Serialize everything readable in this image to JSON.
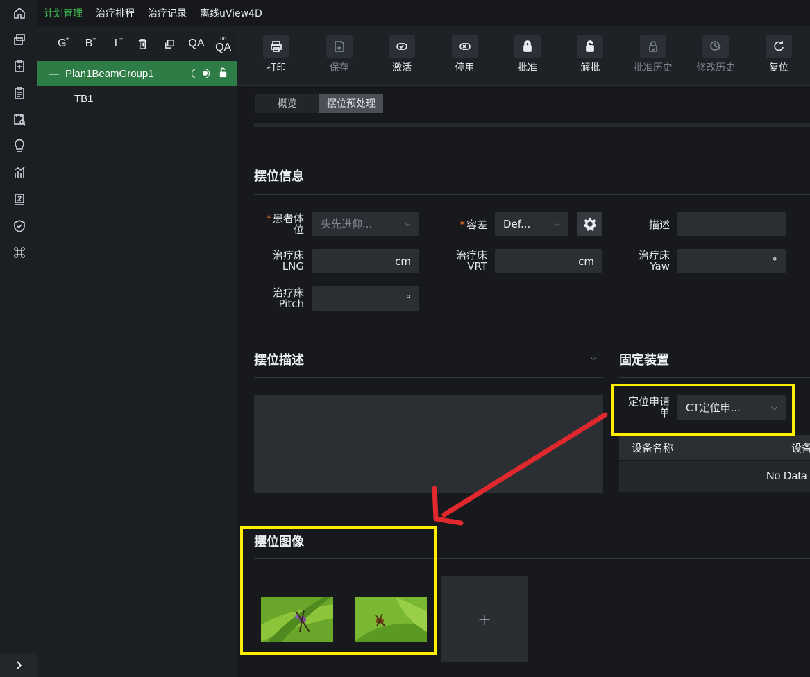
{
  "rail": {
    "icons": [
      "home-icon",
      "copy-stack-icon",
      "clipboard-plus-icon",
      "clipboard-list-icon",
      "calendar-search-icon",
      "lightbulb-icon",
      "chart-icon",
      "badge-2-icon",
      "shield-check-icon",
      "command-icon"
    ]
  },
  "topnav": {
    "tabs": [
      "计划管理",
      "治疗排程",
      "治疗记录",
      "离线uView4D"
    ],
    "active": 0
  },
  "tree": {
    "toolbar": {
      "g": "G",
      "b": "B",
      "i": "I",
      "plus": "+",
      "qa": "QA",
      "unqa": "QA",
      "un": "un"
    },
    "plan": "Plan1BeamGroup1",
    "child": "TB1"
  },
  "toolbar": {
    "print": "打印",
    "save": "保存",
    "activate": "激活",
    "deactivate": "停用",
    "approve": "批准",
    "unapprove": "解批",
    "approve_history": "批准历史",
    "modify_history": "修改历史",
    "reset": "复位"
  },
  "subtabs": {
    "overview": "概览",
    "setup_pre": "摆位预处理"
  },
  "setup_info": {
    "title": "摆位信息",
    "patient_position_label": "患者体位",
    "patient_position_value": "头先进仰...",
    "tolerance_label": "容差",
    "tolerance_value": "Def...",
    "description_label": "描述",
    "lng_label_1": "治疗床",
    "lng_label_2": "LNG",
    "lng_unit": "cm",
    "vrt_label_1": "治疗床",
    "vrt_label_2": "VRT",
    "vrt_unit": "cm",
    "yaw_label_1": "治疗床",
    "yaw_label_2": "Yaw",
    "yaw_unit": "°",
    "pitch_label_1": "治疗床",
    "pitch_label_2": "Pitch",
    "pitch_unit": "°",
    "required_mark": "*"
  },
  "setup_desc": {
    "title": "摆位描述"
  },
  "fixation": {
    "title": "固定装置",
    "request_label_1": "定位申请",
    "request_label_2": "单",
    "request_value": "CT定位申...",
    "col_name": "设备名称",
    "col_params": "设备参数",
    "empty": "No Data"
  },
  "setup_images": {
    "title": "摆位图像",
    "add": "+"
  },
  "colors": {
    "accent_green": "#3fb950",
    "selected_row": "#2f7d46",
    "highlight_yellow": "#ffee00",
    "arrow_red": "#e0282d"
  }
}
